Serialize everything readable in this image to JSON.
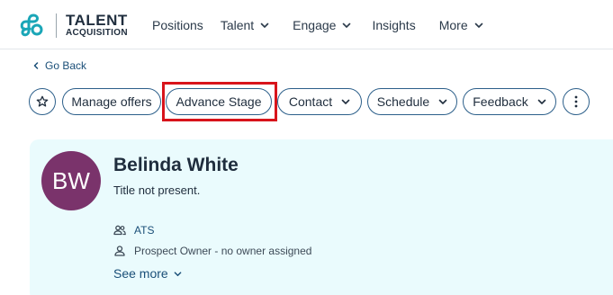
{
  "brand": {
    "line1": "TALENT",
    "line2": "ACQUISITION"
  },
  "nav": {
    "positions": "Positions",
    "talent": "Talent",
    "engage": "Engage",
    "insights": "Insights",
    "more": "More"
  },
  "back": {
    "label": "Go Back"
  },
  "actions": {
    "manage_offers": "Manage offers",
    "advance_stage": "Advance Stage",
    "contact": "Contact",
    "schedule": "Schedule",
    "feedback": "Feedback"
  },
  "profile": {
    "initials": "BW",
    "name": "Belinda White",
    "title": "Title not present.",
    "source": "ATS",
    "owner": "Prospect Owner - no owner assigned",
    "see_more": "See more"
  },
  "colors": {
    "accent": "#1a4f78",
    "avatar": "#7a336b",
    "card_bg": "#eafbfd",
    "highlight": "#d8141b",
    "logo_teal": "#1aa6b7"
  },
  "icons": [
    "logo-mark-icon",
    "chevron-down-icon",
    "chevron-left-icon",
    "star-icon",
    "more-vertical-icon",
    "people-icon",
    "person-icon"
  ]
}
